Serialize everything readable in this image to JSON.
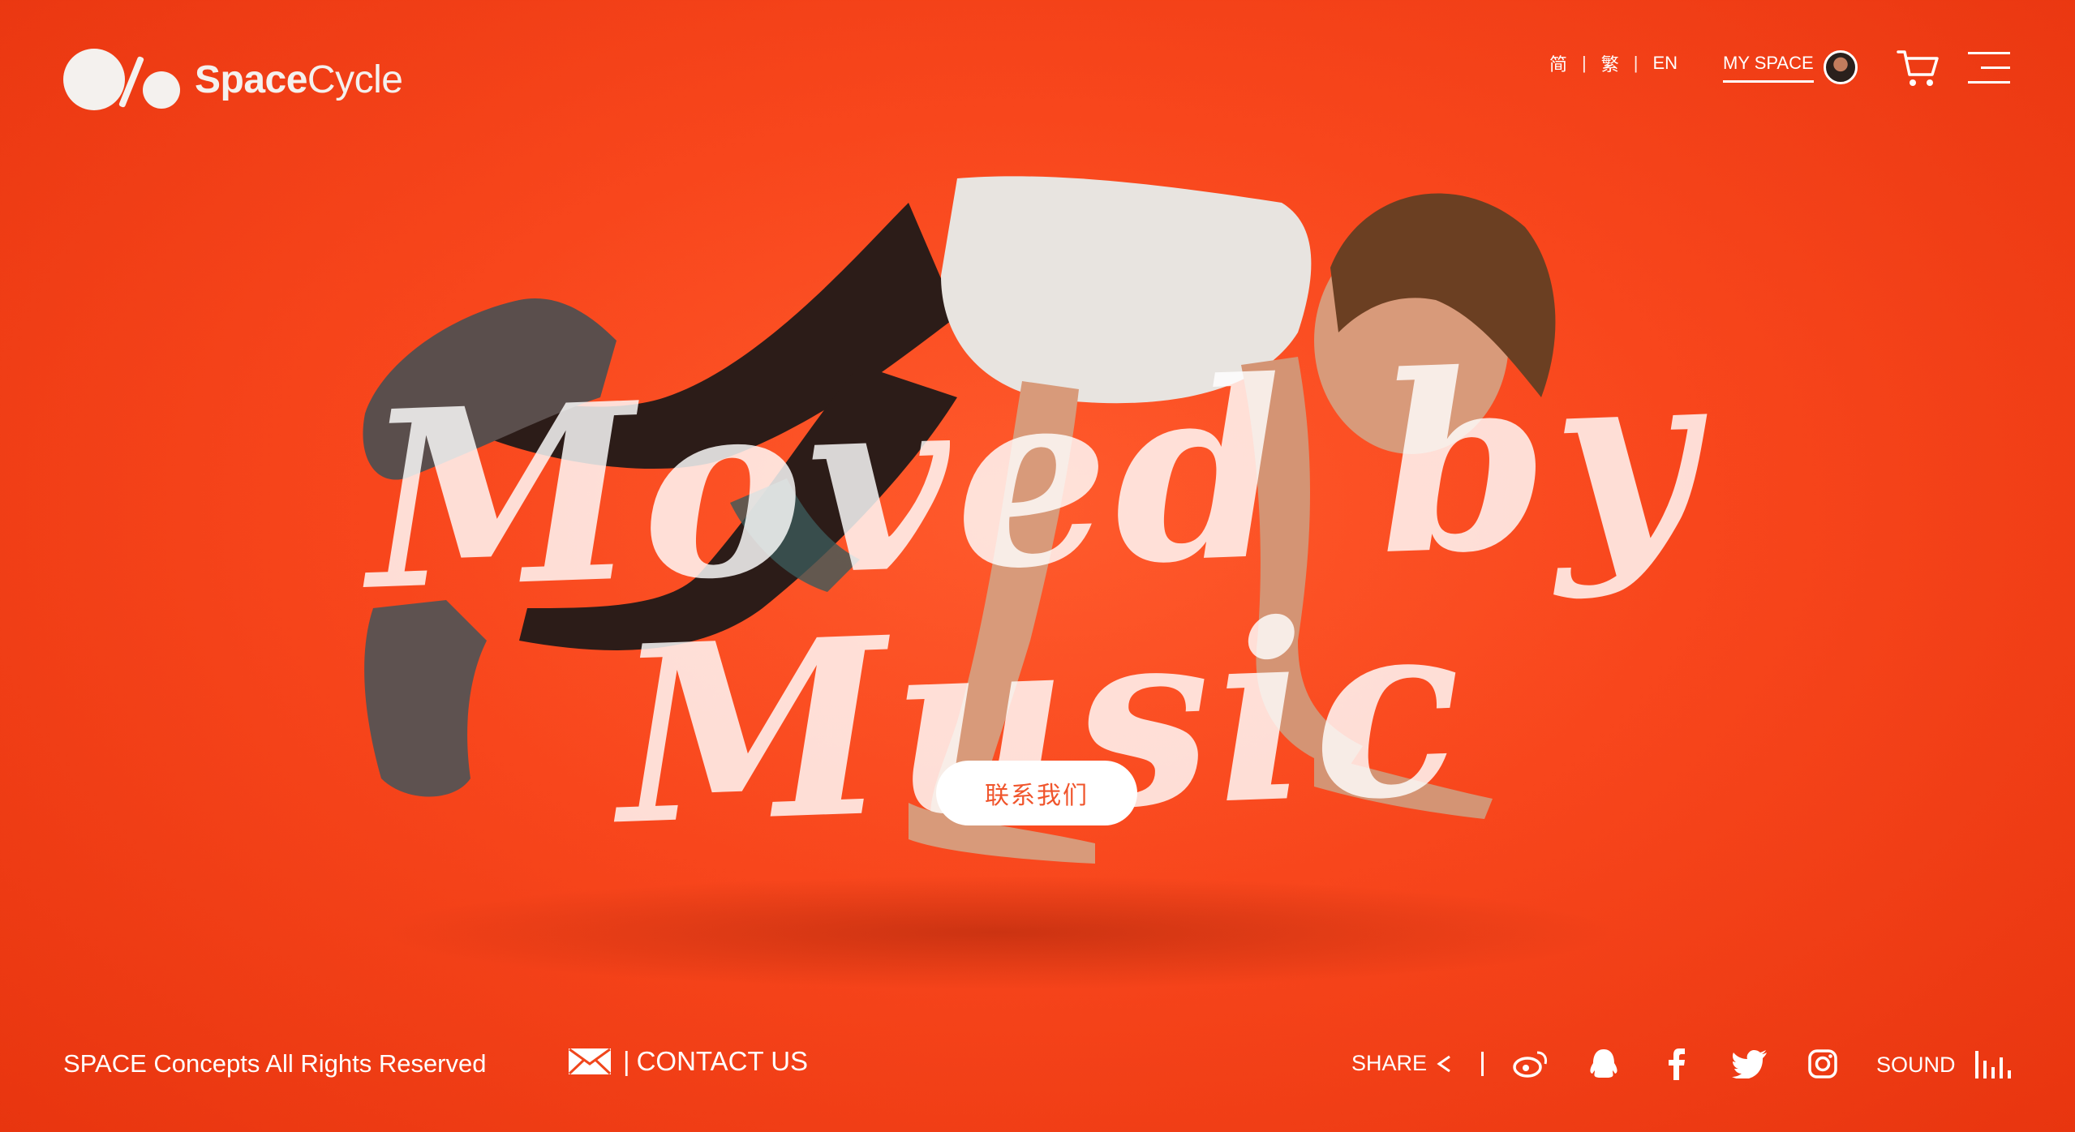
{
  "brand": {
    "name_bold": "Space",
    "name_light": "Cycle"
  },
  "header": {
    "languages": [
      "简",
      "繁",
      "EN"
    ],
    "my_space_label": "MY SPACE"
  },
  "hero": {
    "headline": "Moved by Music",
    "cta_label": "联系我们"
  },
  "footer": {
    "copyright": "SPACE Concepts All Rights Reserved",
    "contact_label": "CONTACT US",
    "contact_pipe": "|",
    "share_label": "SHARE",
    "share_divider": "|",
    "sound_label": "SOUND",
    "social_icons": [
      "weibo-icon",
      "qq-icon",
      "facebook-icon",
      "twitter-icon",
      "instagram-icon"
    ]
  },
  "colors": {
    "background": "#f8461c",
    "cta_text": "#f0552c"
  }
}
